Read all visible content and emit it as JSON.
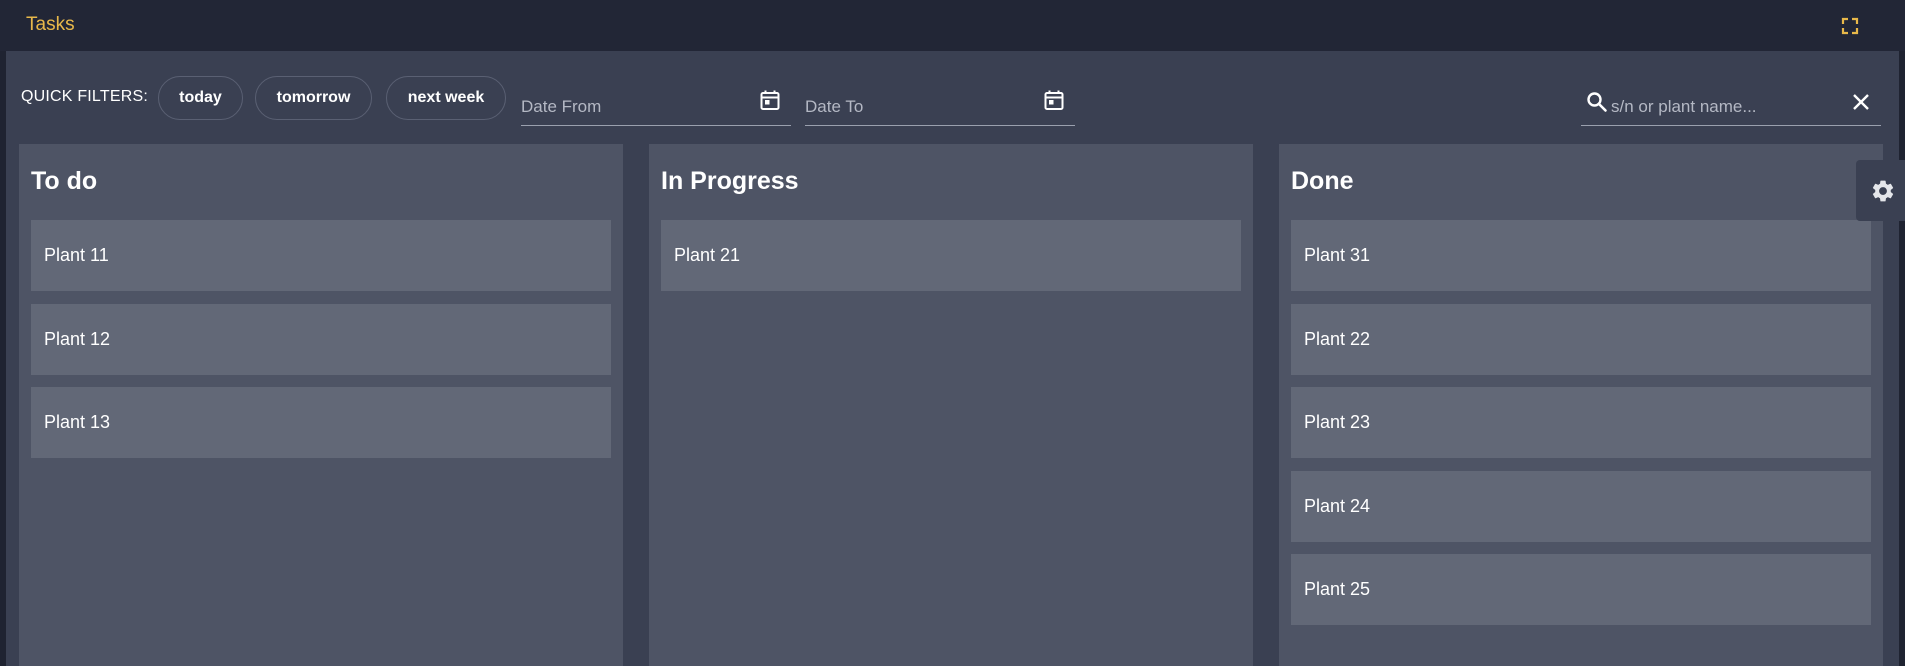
{
  "header": {
    "title": "Tasks"
  },
  "filters": {
    "label": "QUICK FILTERS:",
    "chips": [
      "today",
      "tomorrow",
      "next week"
    ],
    "date_from_placeholder": "Date From",
    "date_to_placeholder": "Date To",
    "search_placeholder": "s/n or plant name..."
  },
  "columns": [
    {
      "title": "To do",
      "cards": [
        "Plant 11",
        "Plant 12",
        "Plant 13"
      ]
    },
    {
      "title": "In Progress",
      "cards": [
        "Plant 21"
      ]
    },
    {
      "title": "Done",
      "cards": [
        "Plant 31",
        "Plant 22",
        "Plant 23",
        "Plant 24",
        "Plant 25"
      ]
    }
  ],
  "colors": {
    "accent": "#e8b84a",
    "panel": "#3a4052",
    "column": "#4e5465",
    "card": "#626877"
  },
  "icons": [
    "fullscreen-icon",
    "calendar-icon",
    "search-icon",
    "close-icon",
    "gear-icon"
  ]
}
